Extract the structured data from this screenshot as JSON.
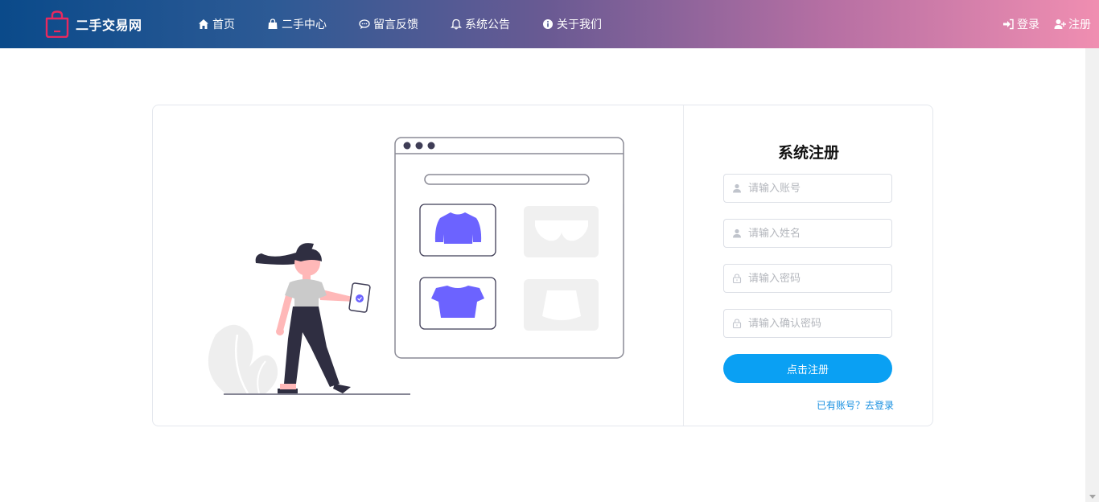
{
  "header": {
    "brand": "二手交易网",
    "nav": [
      {
        "label": "首页",
        "icon": "home-icon"
      },
      {
        "label": "二手中心",
        "icon": "shopping-bag-icon"
      },
      {
        "label": "留言反馈",
        "icon": "comment-icon"
      },
      {
        "label": "系统公告",
        "icon": "bell-icon"
      },
      {
        "label": "关于我们",
        "icon": "info-icon"
      }
    ],
    "auth": {
      "login": "登录",
      "register": "注册"
    }
  },
  "form": {
    "title": "系统注册",
    "fields": {
      "account_placeholder": "请输入账号",
      "name_placeholder": "请输入姓名",
      "password_placeholder": "请输入密码",
      "confirm_placeholder": "请输入确认密码"
    },
    "submit": "点击注册",
    "login_link": "已有账号？去登录"
  },
  "colors": {
    "accent": "#0aa0f3",
    "link": "#1890e0",
    "illustration_purple": "#6c63ff"
  }
}
